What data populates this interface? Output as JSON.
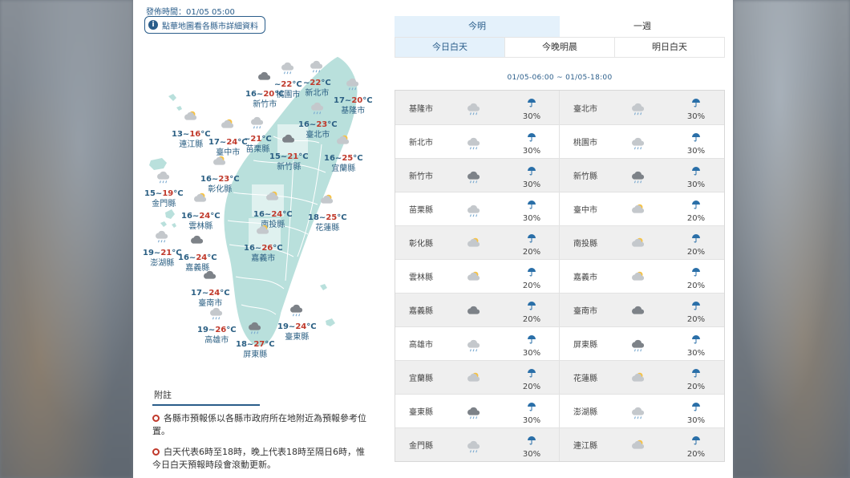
{
  "issue_time": "發佈時間：01/05 05:00",
  "map_hint": "點華地圖看各縣市詳細資料",
  "map_hint_icon": "info-icon",
  "tabs": [
    {
      "label": "今明",
      "active": true
    },
    {
      "label": "一週",
      "active": false
    }
  ],
  "subtabs": [
    {
      "label": "今日白天",
      "active": true
    },
    {
      "label": "今晚明晨",
      "active": false
    },
    {
      "label": "明日白天",
      "active": false
    }
  ],
  "time_range": "01/05-06:00 ~ 01/05-18:00",
  "map_cities": [
    {
      "name": "新竹市",
      "lo": "16",
      "hi": "20",
      "wx": "cloudy"
    },
    {
      "name": "桃園市",
      "lo": "",
      "hi": "22",
      "wx": "rain"
    },
    {
      "name": "新北市",
      "lo": "",
      "hi": "22",
      "wx": "rain"
    },
    {
      "name": "基隆市",
      "lo": "17",
      "hi": "20",
      "wx": "rain"
    },
    {
      "name": "臺北市",
      "lo": "16",
      "hi": "23",
      "wx": "rain"
    },
    {
      "name": "連江縣",
      "lo": "13",
      "hi": "16",
      "wx": "partly-cloudy"
    },
    {
      "name": "臺中市",
      "lo": "17",
      "hi": "24",
      "wx": "partly-cloudy"
    },
    {
      "name": "苗栗縣",
      "lo": "",
      "hi": "21",
      "wx": "rain"
    },
    {
      "name": "新竹縣",
      "lo": "15",
      "hi": "21",
      "wx": "cloudy"
    },
    {
      "name": "宜蘭縣",
      "lo": "16",
      "hi": "25",
      "wx": "partly-cloudy"
    },
    {
      "name": "彰化縣",
      "lo": "16",
      "hi": "23",
      "wx": "partly-cloudy"
    },
    {
      "name": "金門縣",
      "lo": "15",
      "hi": "19",
      "wx": "rain"
    },
    {
      "name": "南投縣",
      "lo": "16",
      "hi": "24",
      "wx": "partly-cloudy"
    },
    {
      "name": "雲林縣",
      "lo": "16",
      "hi": "24",
      "wx": "partly-cloudy"
    },
    {
      "name": "花蓮縣",
      "lo": "18",
      "hi": "25",
      "wx": "partly-cloudy"
    },
    {
      "name": "澎湖縣",
      "lo": "19",
      "hi": "21",
      "wx": "rain"
    },
    {
      "name": "嘉義市",
      "lo": "16",
      "hi": "26",
      "wx": "partly-cloudy"
    },
    {
      "name": "嘉義縣",
      "lo": "16",
      "hi": "24",
      "wx": "cloudy"
    },
    {
      "name": "臺南市",
      "lo": "17",
      "hi": "24",
      "wx": "cloudy"
    },
    {
      "name": "高雄市",
      "lo": "19",
      "hi": "26",
      "wx": "rain"
    },
    {
      "name": "屏東縣",
      "lo": "18",
      "hi": "27",
      "wx": "rain-cloud"
    },
    {
      "name": "臺東縣",
      "lo": "19",
      "hi": "24",
      "wx": "rain-cloud"
    }
  ],
  "forecast_rows": [
    [
      {
        "name": "基隆市",
        "wx": "rain",
        "pop": "30%"
      },
      {
        "name": "臺北市",
        "wx": "rain",
        "pop": "30%"
      }
    ],
    [
      {
        "name": "新北市",
        "wx": "rain",
        "pop": "30%"
      },
      {
        "name": "桃園市",
        "wx": "rain",
        "pop": "30%"
      }
    ],
    [
      {
        "name": "新竹市",
        "wx": "rain-cloud",
        "pop": "30%"
      },
      {
        "name": "新竹縣",
        "wx": "rain-cloud",
        "pop": "30%"
      }
    ],
    [
      {
        "name": "苗栗縣",
        "wx": "rain",
        "pop": "30%"
      },
      {
        "name": "臺中市",
        "wx": "partly-cloudy",
        "pop": "20%"
      }
    ],
    [
      {
        "name": "彰化縣",
        "wx": "partly-cloudy",
        "pop": "20%"
      },
      {
        "name": "南投縣",
        "wx": "partly-cloudy",
        "pop": "20%"
      }
    ],
    [
      {
        "name": "雲林縣",
        "wx": "partly-cloudy",
        "pop": "20%"
      },
      {
        "name": "嘉義市",
        "wx": "partly-cloudy",
        "pop": "20%"
      }
    ],
    [
      {
        "name": "嘉義縣",
        "wx": "cloudy",
        "pop": "20%"
      },
      {
        "name": "臺南市",
        "wx": "cloudy",
        "pop": "20%"
      }
    ],
    [
      {
        "name": "高雄市",
        "wx": "rain",
        "pop": "30%"
      },
      {
        "name": "屏東縣",
        "wx": "rain-cloud",
        "pop": "30%"
      }
    ],
    [
      {
        "name": "宜蘭縣",
        "wx": "partly-cloudy",
        "pop": "20%"
      },
      {
        "name": "花蓮縣",
        "wx": "partly-cloudy",
        "pop": "20%"
      }
    ],
    [
      {
        "name": "臺東縣",
        "wx": "rain-cloud",
        "pop": "30%"
      },
      {
        "name": "澎湖縣",
        "wx": "rain",
        "pop": "30%"
      }
    ],
    [
      {
        "name": "金門縣",
        "wx": "rain",
        "pop": "30%"
      },
      {
        "name": "連江縣",
        "wx": "partly-cloudy",
        "pop": "20%"
      }
    ]
  ],
  "notes": {
    "title": "附註",
    "items": [
      "各縣市預報係以各縣市政府所在地附近為預報參考位置。",
      "白天代表6時至18時，晚上代表18時至隔日6時，惟今日白天預報時段會滾動更新。"
    ]
  },
  "colors": {
    "map_fill": "#b9e0dc",
    "accent": "#2a5d8a",
    "high_temp": "#c0392b",
    "umbrella": "#2a6fa8"
  }
}
